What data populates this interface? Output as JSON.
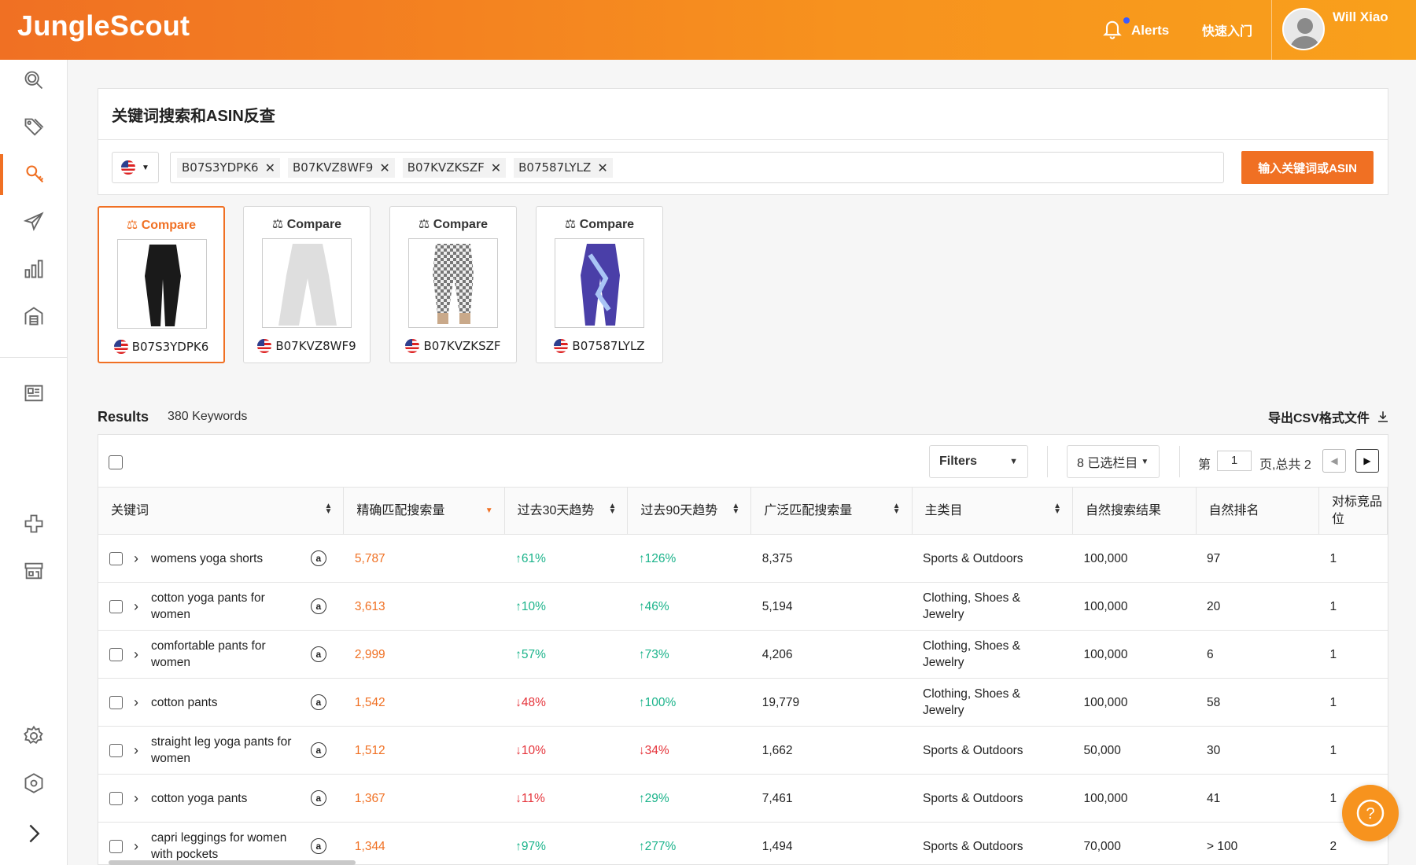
{
  "app": {
    "logo": "JungleScout"
  },
  "topbar": {
    "alerts": "Alerts",
    "quick": "快速入门",
    "username": "Will Xiao"
  },
  "search": {
    "title": "关键词搜索和ASIN反查",
    "tags": [
      "B07S3YDPK6",
      "B07KVZ8WF9",
      "B07KVZKSZF",
      "B07587LYLZ"
    ],
    "button": "输入关键词或ASIN"
  },
  "products": [
    {
      "compare": "Compare",
      "asin": "B07S3YDPK6",
      "color": "#1a1a1a"
    },
    {
      "compare": "Compare",
      "asin": "B07KVZ8WF9",
      "color": "#dcdcdc"
    },
    {
      "compare": "Compare",
      "asin": "B07KVZKSZF",
      "color": "#9a9a9a"
    },
    {
      "compare": "Compare",
      "asin": "B07587LYLZ",
      "color": "#4a3fa8"
    }
  ],
  "results": {
    "label": "Results",
    "count": "380 Keywords",
    "export": "导出CSV格式文件"
  },
  "toolbar": {
    "filters": "Filters",
    "columns": "8 已选栏目",
    "page_pre": "第",
    "page": "1",
    "page_post": "页,总共 2"
  },
  "columns": [
    "关键词",
    "精确匹配搜索量",
    "过去30天趋势",
    "过去90天趋势",
    "广泛匹配搜索量",
    "主类目",
    "自然搜索结果",
    "自然排名",
    "对标竞品位"
  ],
  "rows": [
    {
      "keyword": "womens yoga shorts",
      "exact": "5,787",
      "t30": "61%",
      "t30dir": "up",
      "t90": "126%",
      "t90dir": "up",
      "broad": "8,375",
      "category": "Sports & Outdoors",
      "results": "100,000",
      "rank": "97",
      "rel": "1"
    },
    {
      "keyword": "cotton yoga pants for women",
      "exact": "3,613",
      "t30": "10%",
      "t30dir": "up",
      "t90": "46%",
      "t90dir": "up",
      "broad": "5,194",
      "category": "Clothing, Shoes & Jewelry",
      "results": "100,000",
      "rank": "20",
      "rel": "1"
    },
    {
      "keyword": "comfortable pants for women",
      "exact": "2,999",
      "t30": "57%",
      "t30dir": "up",
      "t90": "73%",
      "t90dir": "up",
      "broad": "4,206",
      "category": "Clothing, Shoes & Jewelry",
      "results": "100,000",
      "rank": "6",
      "rel": "1"
    },
    {
      "keyword": "cotton pants",
      "exact": "1,542",
      "t30": "48%",
      "t30dir": "down",
      "t90": "100%",
      "t90dir": "up",
      "broad": "19,779",
      "category": "Clothing, Shoes & Jewelry",
      "results": "100,000",
      "rank": "58",
      "rel": "1"
    },
    {
      "keyword": "straight leg yoga pants for women",
      "exact": "1,512",
      "t30": "10%",
      "t30dir": "down",
      "t90": "34%",
      "t90dir": "down",
      "broad": "1,662",
      "category": "Sports & Outdoors",
      "results": "50,000",
      "rank": "30",
      "rel": "1"
    },
    {
      "keyword": "cotton yoga pants",
      "exact": "1,367",
      "t30": "11%",
      "t30dir": "down",
      "t90": "29%",
      "t90dir": "up",
      "broad": "7,461",
      "category": "Sports & Outdoors",
      "results": "100,000",
      "rank": "41",
      "rel": "1"
    },
    {
      "keyword": "capri leggings for women with pockets",
      "exact": "1,344",
      "t30": "97%",
      "t30dir": "up",
      "t90": "277%",
      "t90dir": "up",
      "broad": "1,494",
      "category": "Sports & Outdoors",
      "results": "70,000",
      "rank": "> 100",
      "rel": "2"
    }
  ],
  "icons": {
    "sidebar": [
      "search-icon",
      "tags-icon",
      "keyword-search-icon",
      "launch-icon",
      "bar-chart-icon",
      "warehouse-icon",
      "news-icon",
      "puzzle-icon",
      "store-icon",
      "gear-icon",
      "shield-icon",
      "expand-icon"
    ]
  },
  "colors": {
    "accent": "#f07023",
    "up": "#1ab38a",
    "down": "#e5333a"
  }
}
